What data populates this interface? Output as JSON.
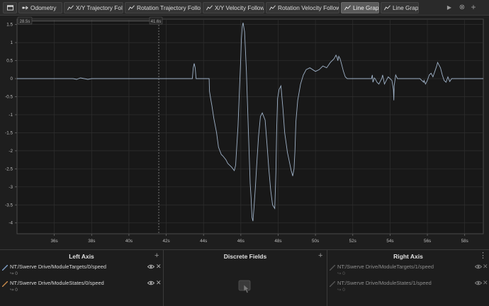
{
  "tabs": [
    {
      "id": "home",
      "label": "",
      "icon": "window-icon"
    },
    {
      "id": "odometry",
      "label": "Odometry",
      "icon": "odometry-icon"
    },
    {
      "id": "xy-trajectory",
      "label": "X/Y Trajectory Following",
      "icon": "graph-icon"
    },
    {
      "id": "rotation-trajectory",
      "label": "Rotation Trajectory Following",
      "icon": "graph-icon"
    },
    {
      "id": "xy-velocity",
      "label": "X/Y Velocity Following",
      "icon": "graph-icon"
    },
    {
      "id": "rotation-velocity",
      "label": "Rotation Velocity Following",
      "icon": "graph-icon"
    },
    {
      "id": "line-graph-1",
      "label": "Line Graph",
      "icon": "graph-icon",
      "active": true
    },
    {
      "id": "line-graph-2",
      "label": "Line Graph",
      "icon": "graph-icon"
    }
  ],
  "toolbar": {
    "play": "▶",
    "close": "⊗",
    "add": "+"
  },
  "timeline": {
    "range_start": "28.5s",
    "cursor": "41.6s"
  },
  "chart_data": {
    "type": "line",
    "xlim": [
      34.0,
      59.0
    ],
    "ylim": [
      -4.3,
      1.65
    ],
    "x_ticks": [
      36,
      38,
      40,
      42,
      44,
      46,
      48,
      50,
      52,
      54,
      56,
      58
    ],
    "x_tick_labels": [
      "36s",
      "38s",
      "40s",
      "42s",
      "44s",
      "46s",
      "48s",
      "50s",
      "52s",
      "54s",
      "56s",
      "58s"
    ],
    "y_ticks": [
      1.5,
      1,
      0.5,
      0,
      -0.5,
      -1,
      -1.5,
      -2,
      -2.5,
      -3,
      -3.5,
      -4
    ],
    "y_tick_labels": [
      "1.5",
      "1",
      "0.5",
      "0",
      "-0.5",
      "-1",
      "-1.5",
      "-2",
      "-2.5",
      "-3",
      "-3.5",
      "-4"
    ],
    "grid": true,
    "cursor_x": 41.6,
    "series": [
      {
        "color": "#9fb2c8",
        "x": [
          34.0,
          37.0,
          37.2,
          37.4,
          37.6,
          37.8,
          38.0,
          38.1,
          43.4,
          43.45,
          43.5,
          43.55,
          43.6,
          44.3,
          44.32,
          44.38,
          44.45,
          44.55,
          44.7,
          44.8,
          44.95,
          45.05,
          45.2,
          45.3,
          45.5,
          45.65,
          45.72,
          45.78,
          45.85,
          45.92,
          46.0,
          46.03,
          46.08,
          46.12,
          46.2,
          46.3,
          46.4,
          46.5,
          46.55,
          46.6,
          46.65,
          46.7,
          46.78,
          46.85,
          46.95,
          47.05,
          47.15,
          47.3,
          47.4,
          47.5,
          47.6,
          47.7,
          47.82,
          47.88,
          47.92,
          47.97,
          48.05,
          48.15,
          48.25,
          48.35,
          48.5,
          48.6,
          48.7,
          48.78,
          48.85,
          48.9,
          48.95,
          49.05,
          49.2,
          49.35,
          49.5,
          49.7,
          50.0,
          50.2,
          50.4,
          50.6,
          50.8,
          51.0,
          51.1,
          51.15,
          51.2,
          51.25,
          51.32,
          51.4,
          51.5,
          51.6,
          51.7,
          51.8,
          52.0,
          52.2,
          52.5,
          53.0,
          53.05,
          53.08,
          53.12,
          53.15,
          53.2,
          53.3,
          53.4,
          53.5,
          53.55,
          53.6,
          53.7,
          53.8,
          53.9,
          54.0,
          54.1,
          54.18,
          54.2,
          54.22,
          54.3,
          54.4,
          54.5,
          54.6,
          54.7,
          55.0,
          55.2,
          55.4,
          55.6,
          55.8,
          55.82,
          55.9,
          56.0,
          56.1,
          56.2,
          56.3,
          56.4,
          56.5,
          56.55,
          56.6,
          56.7,
          56.8,
          56.9,
          57.0,
          57.1,
          57.2,
          57.3,
          57.5,
          58.0,
          59.0
        ],
        "y": [
          0,
          0,
          -0.02,
          0.02,
          0,
          -0.02,
          0,
          0,
          0,
          0.3,
          0.42,
          0.3,
          0,
          0,
          -0.35,
          -0.55,
          -0.75,
          -1.1,
          -1.5,
          -1.9,
          -2.1,
          -2.15,
          -2.25,
          -2.35,
          -2.45,
          -2.55,
          -2.4,
          -1.9,
          -1.3,
          -0.4,
          0.6,
          1.1,
          1.45,
          1.55,
          1.3,
          0.2,
          -1.4,
          -2.9,
          -3.3,
          -3.85,
          -3.95,
          -3.6,
          -3.0,
          -2.4,
          -1.6,
          -1.05,
          -0.95,
          -1.15,
          -1.8,
          -2.5,
          -3.1,
          -3.5,
          -3.6,
          -2.6,
          -1.4,
          -0.55,
          -0.3,
          -0.2,
          -0.8,
          -1.5,
          -2.05,
          -2.3,
          -2.55,
          -2.7,
          -2.5,
          -2.0,
          -1.2,
          -0.6,
          -0.15,
          0.1,
          0.25,
          0.3,
          0.2,
          0.25,
          0.35,
          0.3,
          0.45,
          0.55,
          0.65,
          0.6,
          0.5,
          0.62,
          0.55,
          0.4,
          0.2,
          0.05,
          0,
          0,
          0,
          0,
          0,
          0,
          0.1,
          -0.1,
          -0.05,
          0.02,
          0,
          -0.1,
          -0.15,
          -0.05,
          0,
          0.1,
          -0.15,
          -0.05,
          0.05,
          0,
          -0.05,
          -0.3,
          -0.6,
          -0.2,
          0.1,
          0,
          0,
          0,
          0,
          0,
          0,
          0,
          0,
          -0.1,
          -0.05,
          -0.15,
          -0.05,
          0.1,
          0.15,
          0.05,
          0.2,
          0.35,
          0.45,
          0.4,
          0.3,
          0.1,
          -0.05,
          -0.1,
          0.05,
          -0.08,
          0,
          0,
          0,
          0
        ]
      }
    ]
  },
  "left_axis": {
    "title": "Left Axis",
    "fields": [
      {
        "name": "NT:/Swerve Drive/ModuleTargets/0/speed",
        "value": "0",
        "color": "#7fa0c8"
      },
      {
        "name": "NT:/Swerve Drive/ModuleStates/0/speed",
        "value": "0",
        "color": "#c88a4a"
      }
    ]
  },
  "discrete": {
    "title": "Discrete Fields",
    "icon": "drop-field-icon"
  },
  "right_axis": {
    "title": "Right Axis",
    "fields": [
      {
        "name": "NT:/Swerve Drive/ModuleTargets/1/speed",
        "value": "0",
        "color": "#555555"
      },
      {
        "name": "NT:/Swerve Drive/ModuleStates/1/speed",
        "value": "0",
        "color": "#555555"
      }
    ]
  },
  "panel_buttons": {
    "add": "+",
    "more": "⋮",
    "close": "✕"
  }
}
